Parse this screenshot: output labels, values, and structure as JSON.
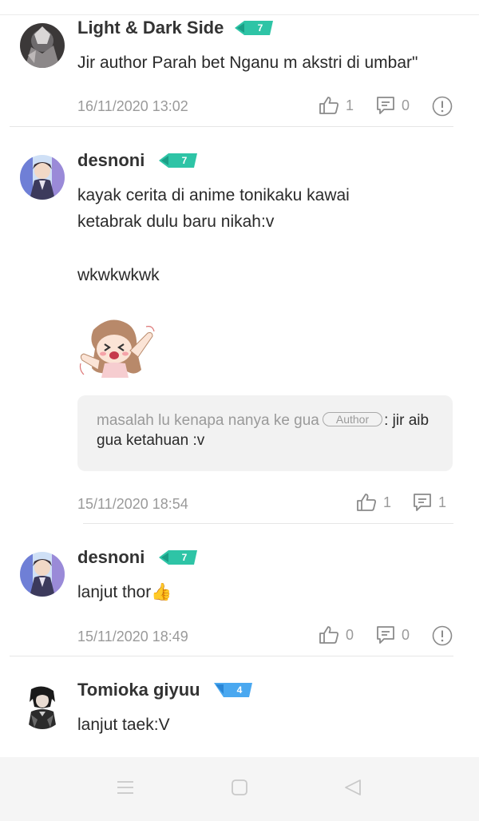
{
  "comments": [
    {
      "username": "Light & Dark Side",
      "level": "7",
      "lines": [
        "Jir author Parah bet Nganu m akstri di umbar\""
      ],
      "timestamp": "16/11/2020 13:02",
      "likes": "1",
      "replies": "0"
    },
    {
      "username": "desnoni",
      "level": "7",
      "lines": [
        "kayak cerita di anime tonikaku kawai",
        "ketabrak dulu baru nikah:v",
        "wkwkwkwk"
      ],
      "reply": {
        "text_before": "masalah lu kenapa nanya ke gua",
        "tag": "Author",
        "text_after": ": jir aib",
        "text_line2": "gua ketahuan :v"
      },
      "timestamp": "15/11/2020 18:54",
      "likes": "1",
      "replies": "1"
    },
    {
      "username": "desnoni",
      "level": "7",
      "lines": [
        "lanjut thor"
      ],
      "emoji": "👍",
      "timestamp": "15/11/2020 18:49",
      "likes": "0",
      "replies": "0"
    },
    {
      "username": "Tomioka giyuu",
      "level": "4",
      "lines": [
        "lanjut taek:V"
      ]
    }
  ],
  "colors": {
    "badge_teal": "#2ec4a6",
    "badge_blue": "#4aa8f0"
  }
}
